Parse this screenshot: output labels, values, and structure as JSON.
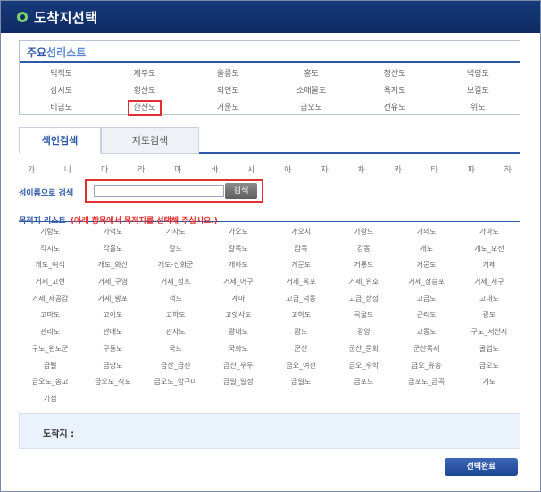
{
  "window": {
    "title": "도착지선택"
  },
  "islands": {
    "header_strong": "주요",
    "header_light": "섬리스트",
    "items": [
      "덕적도",
      "제주도",
      "울릉도",
      "홍도",
      "청산도",
      "백령도",
      "삼시도",
      "횡산도",
      "외연도",
      "소매물도",
      "욕지도",
      "보길도",
      "비금도",
      "한산도",
      "거문도",
      "금오도",
      "선유도",
      "위도"
    ],
    "selected": "한산도"
  },
  "tabs": [
    {
      "label": "색인검색",
      "active": true
    },
    {
      "label": "지도검색",
      "active": false
    }
  ],
  "consonants": [
    "가",
    "나",
    "다",
    "라",
    "마",
    "바",
    "사",
    "아",
    "자",
    "차",
    "카",
    "타",
    "파",
    "하"
  ],
  "search": {
    "label": "섬이름으로 검색",
    "value": "",
    "button_label": "검색"
  },
  "destinations": {
    "label": "목적지 리스트",
    "note": "(아래 항목에서 목적지를 선택해 주십시오.)",
    "items": [
      "가랑도",
      "가덕도",
      "가사도",
      "가오도",
      "가오치",
      "가왕도",
      "가의도",
      "가마도",
      "각시도",
      "각흘도",
      "갈도",
      "갈목도",
      "감목",
      "감동",
      "개도",
      "개도_모전",
      "개도_여석",
      "개도_화산",
      "개도-신화군",
      "개야도",
      "거문도",
      "거룡도",
      "거문도",
      "거제",
      "거제_고현",
      "거제_구영",
      "거제_성포",
      "거제_어구",
      "거제_옥포",
      "거제_유호",
      "거제_장승포",
      "거제_저구",
      "거제_제공감",
      "거제_황포",
      "객도",
      "계마",
      "고금_덕동",
      "고금_상정",
      "고금도",
      "고대도",
      "고마도",
      "고이도",
      "고하도",
      "고랫사도",
      "고하도",
      "곡울도",
      "곤리도",
      "광도",
      "관리도",
      "관매도",
      "관사도",
      "광대도",
      "광도",
      "광양",
      "교동도",
      "구도_서산시",
      "구도_완도군",
      "구룡도",
      "국도",
      "국화도",
      "군산",
      "군산_문회",
      "군산목제",
      "굴업도",
      "금렬",
      "금당도",
      "금산_금진",
      "금산_우두",
      "금오_여천",
      "금오_우학",
      "금오_유송",
      "금오도",
      "금오도_송고",
      "금오도_직포",
      "금오도_함구미",
      "금일_일정",
      "금일도",
      "금포도",
      "금포도_금곡",
      "기도",
      "기섬"
    ]
  },
  "summary": {
    "label": "도착지 :"
  },
  "confirm": {
    "label": "선택완료"
  }
}
